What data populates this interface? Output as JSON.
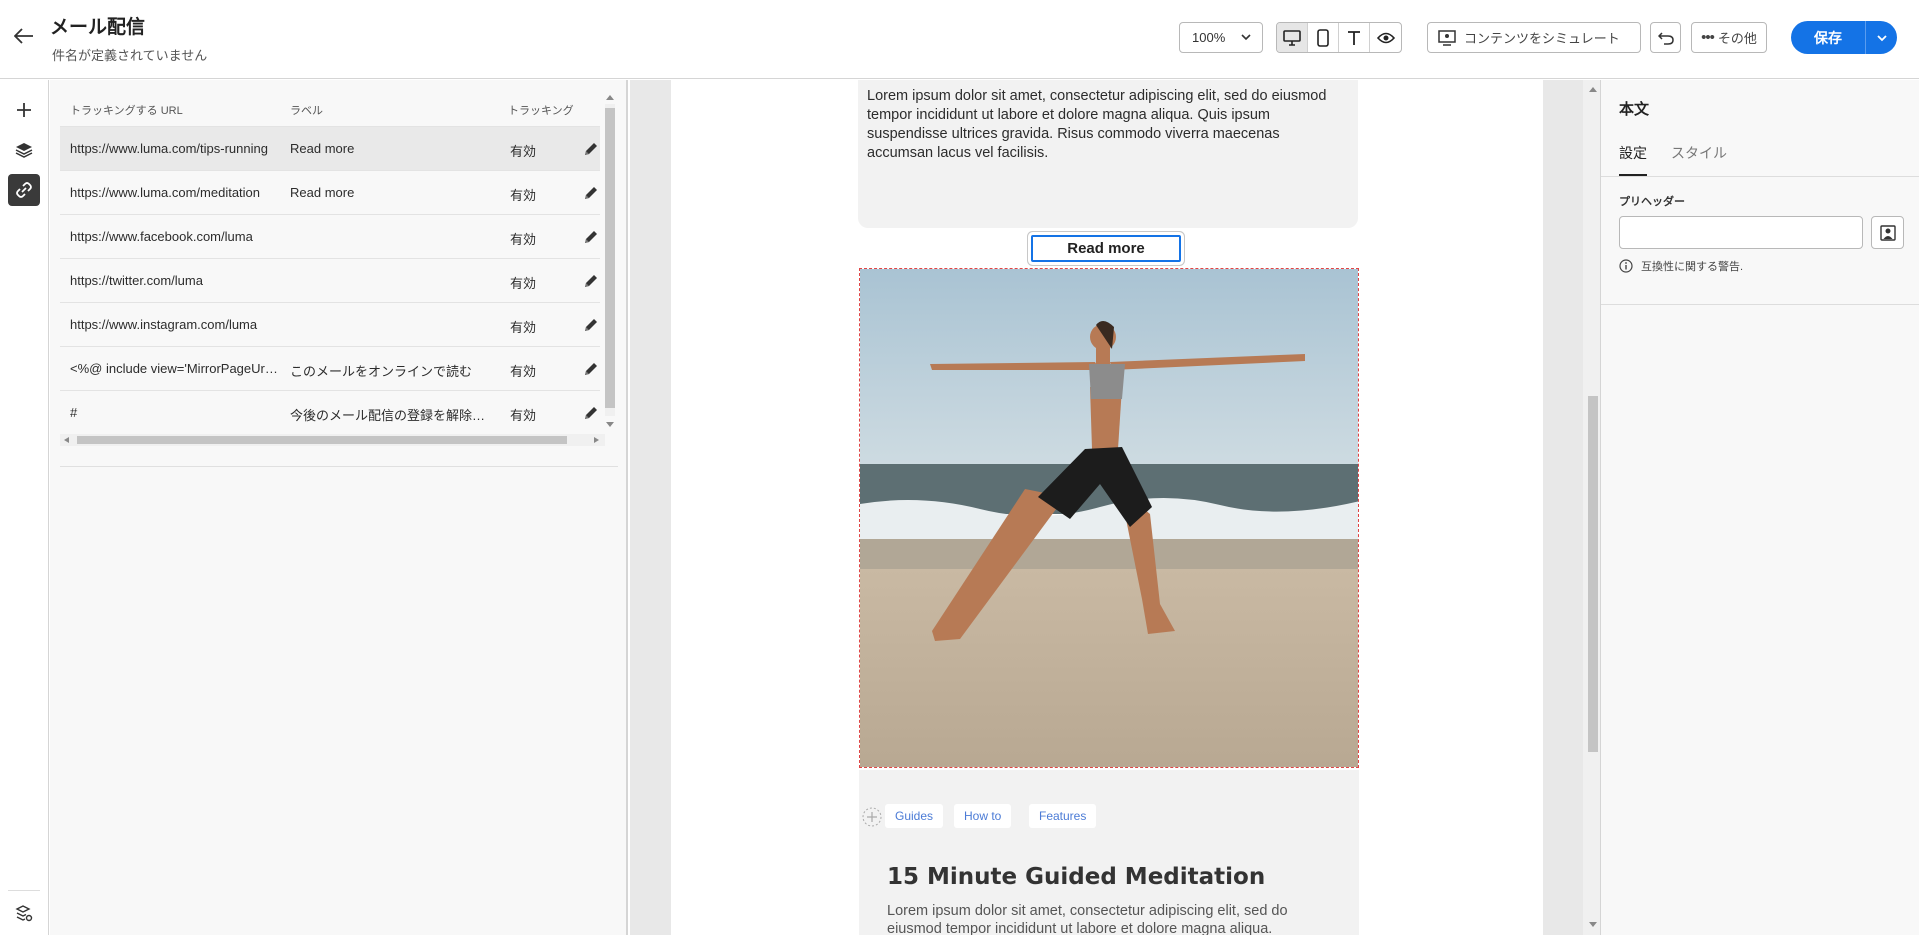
{
  "header": {
    "title": "メール配信",
    "subtitle": "件名が定義されていません",
    "zoom": "100%",
    "simulate_label": "コンテンツをシミュレート",
    "more_label": "その他",
    "save_label": "保存"
  },
  "link_table": {
    "headers": {
      "url": "トラッキングする URL",
      "label": "ラベル",
      "tracking": "トラッキング"
    },
    "rows": [
      {
        "url": "https://www.luma.com/tips-running",
        "label": "Read more",
        "tracking": "有効"
      },
      {
        "url": "https://www.luma.com/meditation",
        "label": "Read more",
        "tracking": "有効"
      },
      {
        "url": "https://www.facebook.com/luma",
        "label": "",
        "tracking": "有効"
      },
      {
        "url": "https://twitter.com/luma",
        "label": "",
        "tracking": "有効"
      },
      {
        "url": "https://www.instagram.com/luma",
        "label": "",
        "tracking": "有効"
      },
      {
        "url": "<%@ include view='MirrorPageUrl' %>",
        "label": "このメールをオンラインで読む",
        "tracking": "有効"
      },
      {
        "url": "#",
        "label": "今後のメール配信の登録を解除する",
        "tracking": "有効"
      }
    ]
  },
  "email": {
    "intro_text": "Lorem ipsum dolor sit amet, consectetur adipiscing elit, sed do eiusmod tempor incididunt ut labore et dolore magna aliqua. Quis ipsum suspendisse ultrices gravida. Risus commodo viverra maecenas accumsan lacus vel facilisis.",
    "button_label": "Read more",
    "tags": [
      "Guides",
      "How to",
      "Features"
    ],
    "card_title": "15 Minute Guided Meditation",
    "card_body": "Lorem ipsum dolor sit amet, consectetur adipiscing elit, sed do eiusmod tempor incididunt ut labore et dolore magna aliqua."
  },
  "props": {
    "title": "本文",
    "tabs": [
      "設定",
      "スタイル"
    ],
    "preheader_label": "プリヘッダー",
    "preheader_value": "",
    "warning": "互換性に関する警告."
  },
  "colors": {
    "accent": "#1473e6",
    "selection": "#e04545"
  }
}
